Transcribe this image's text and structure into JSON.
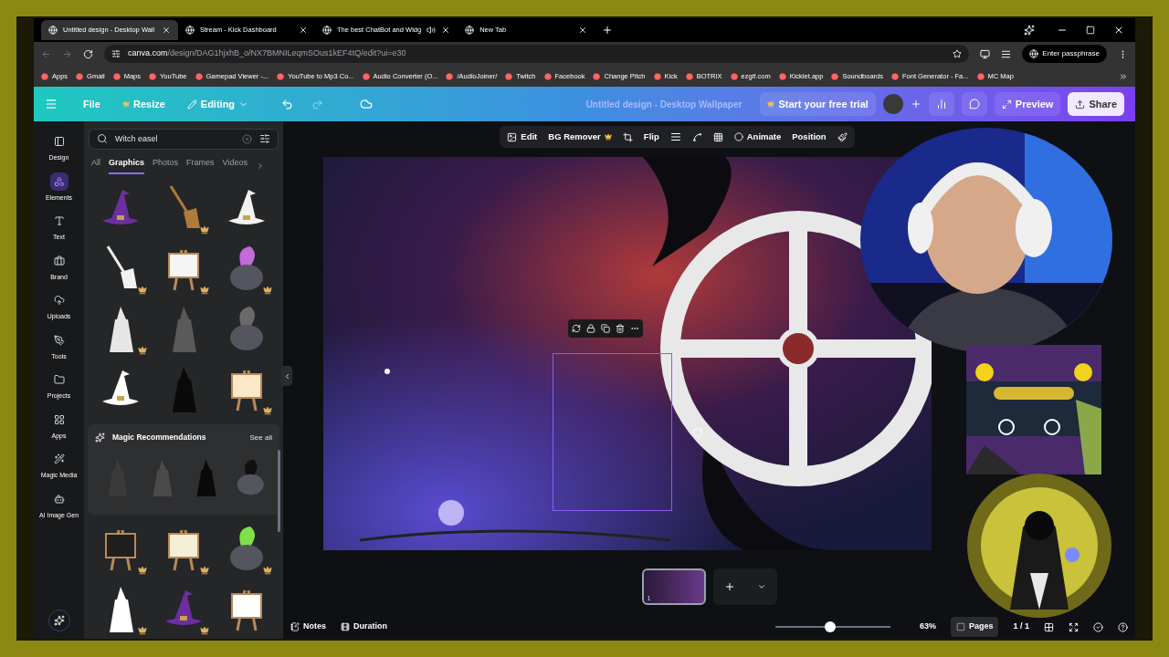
{
  "browser": {
    "tabs": [
      {
        "title": "Untitled design - Desktop Wall",
        "selected": true,
        "audio": false
      },
      {
        "title": "Stream - Kick Dashboard",
        "selected": false,
        "audio": false
      },
      {
        "title": "The best ChatBot and Widg",
        "selected": false,
        "audio": true
      },
      {
        "title": "New Tab",
        "selected": false,
        "audio": false
      }
    ],
    "address_host": "canva.com",
    "address_path": "/design/DAG1hjxhB_o/NX7BMNILeqmSOus1kEF4tQ/edit?ui=e30",
    "passphrase": "Enter passphrase",
    "bookmarks": [
      "Apps",
      "Gmail",
      "Maps",
      "YouTube",
      "Gamepad Viewer -...",
      "YouTube to Mp3 Co...",
      "Audio Converter (O...",
      "/AudioJoiner/",
      "Twitch",
      "Facebook",
      "Change Pitch",
      "Kick",
      "BOTRIX",
      "ezgif.com",
      "Kicklet.app",
      "Soundboards",
      "Font Generator - Fa...",
      "MC Map"
    ]
  },
  "header": {
    "file": "File",
    "resize": "Resize",
    "editing": "Editing",
    "title": "Untitled design - Desktop Wallpaper",
    "trial": "Start your free trial",
    "preview": "Preview",
    "share": "Share"
  },
  "rail": [
    {
      "label": "Design",
      "selected": false
    },
    {
      "label": "Elements",
      "selected": true
    },
    {
      "label": "Text",
      "selected": false
    },
    {
      "label": "Brand",
      "selected": false
    },
    {
      "label": "Uploads",
      "selected": false
    },
    {
      "label": "Tools",
      "selected": false
    },
    {
      "label": "Projects",
      "selected": false
    },
    {
      "label": "Apps",
      "selected": false
    },
    {
      "label": "Magic Media",
      "selected": false
    },
    {
      "label": "AI Image Gen",
      "selected": false
    }
  ],
  "panel": {
    "search": "Witch easel",
    "filters": [
      {
        "label": "All",
        "selected": false
      },
      {
        "label": "Graphics",
        "selected": true
      },
      {
        "label": "Photos",
        "selected": false
      },
      {
        "label": "Frames",
        "selected": false
      },
      {
        "label": "Videos",
        "selected": false
      }
    ],
    "graphics_top": [
      {
        "kind": "hat",
        "color": "#6b2fa0",
        "premium": false
      },
      {
        "kind": "broom",
        "color": "#b07a3a",
        "premium": true
      },
      {
        "kind": "hat",
        "color": "#f2f2f2",
        "premium": false
      },
      {
        "kind": "broom",
        "color": "#f2f2f2",
        "premium": true
      },
      {
        "kind": "easel",
        "color": "#f5f5f5",
        "premium": true
      },
      {
        "kind": "cauldron",
        "color": "#c36bd6",
        "premium": true
      },
      {
        "kind": "witch",
        "color": "#e6e6e6",
        "premium": true
      },
      {
        "kind": "witch",
        "color": "#5a5a5a",
        "premium": false
      },
      {
        "kind": "cauldron",
        "color": "#6a6a6a",
        "premium": false
      },
      {
        "kind": "hat",
        "color": "#ffffff",
        "premium": false
      },
      {
        "kind": "witch",
        "color": "#0a0a0a",
        "premium": false
      },
      {
        "kind": "easel",
        "color": "#fbe8c8",
        "premium": true
      }
    ],
    "magic_title": "Magic Recommendations",
    "see_all": "See all",
    "magic": [
      {
        "kind": "witch",
        "color": "#3a3a3a"
      },
      {
        "kind": "witch",
        "color": "#4a4a4a"
      },
      {
        "kind": "witch",
        "color": "#0a0a0a"
      },
      {
        "kind": "cauldron",
        "color": "#111111"
      }
    ],
    "graphics_bottom": [
      {
        "kind": "easel",
        "color": "#1f1f1f",
        "premium": true
      },
      {
        "kind": "easel",
        "color": "#f5efd8",
        "premium": true
      },
      {
        "kind": "cauldron",
        "color": "#7ee04a",
        "premium": true
      },
      {
        "kind": "witch",
        "color": "#ffffff",
        "premium": true
      },
      {
        "kind": "hat",
        "color": "#6b2fa0",
        "premium": true
      },
      {
        "kind": "easel",
        "color": "#ffffff",
        "premium": false
      }
    ]
  },
  "toolbar": {
    "edit": "Edit",
    "bg_remover": "BG Remover",
    "flip": "Flip",
    "animate": "Animate",
    "position": "Position"
  },
  "footer": {
    "page_number": "1",
    "notes": "Notes",
    "duration": "Duration",
    "zoom": {
      "level": 0.48
    },
    "zoom_text": "63%",
    "pages": "Pages",
    "page_count": "1 / 1"
  }
}
